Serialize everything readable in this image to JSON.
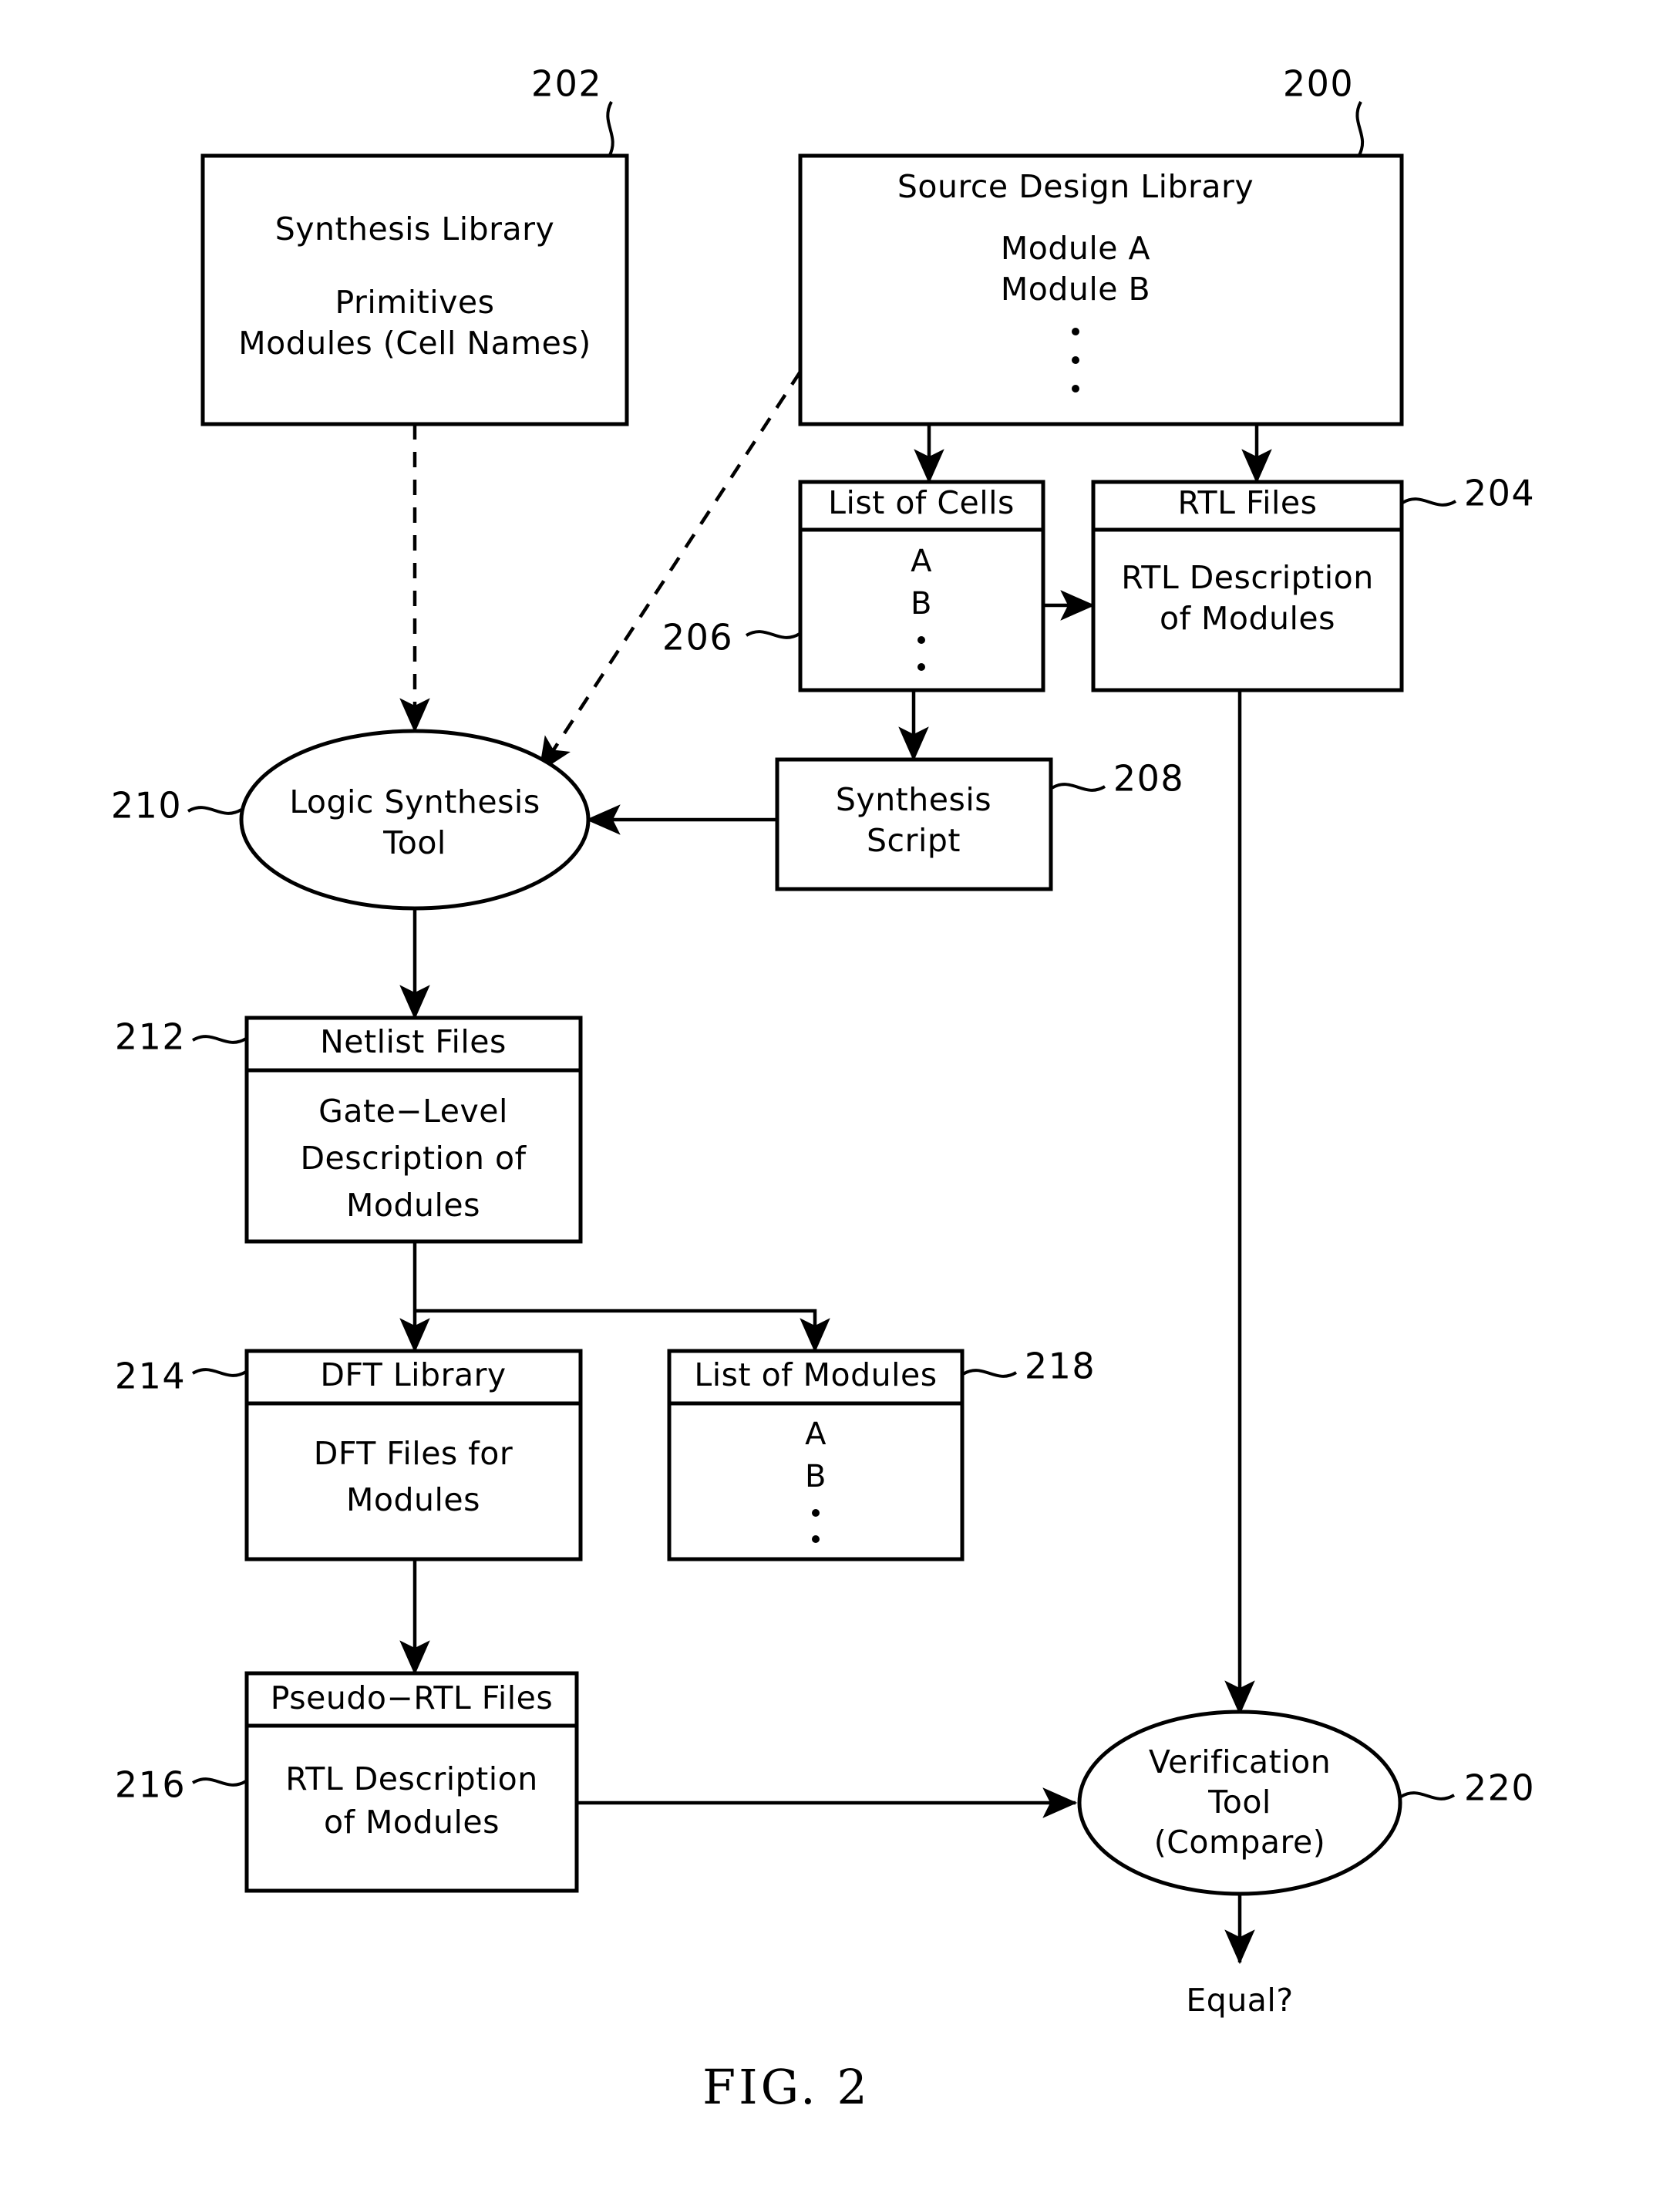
{
  "figure": {
    "caption": "FIG. 2",
    "terminal_label": "Equal?"
  },
  "nodes": {
    "synthesis_library": {
      "ref": "202",
      "title": "Synthesis Library",
      "line1": "Primitives",
      "line2": "Modules (Cell Names)"
    },
    "source_design_library": {
      "ref": "200",
      "title": "Source Design Library",
      "item1": "Module A",
      "item2": "Module B",
      "ellipsis": "vertical-dots"
    },
    "list_of_cells": {
      "ref": "206",
      "header": "List of Cells",
      "item1": "A",
      "item2": "B",
      "ellipsis": "vertical-dots"
    },
    "rtl_files": {
      "ref": "204",
      "header": "RTL Files",
      "body_line1": "RTL Description",
      "body_line2": "of Modules"
    },
    "synthesis_script": {
      "ref": "208",
      "line1": "Synthesis",
      "line2": "Script"
    },
    "logic_synthesis_tool": {
      "ref": "210",
      "line1": "Logic Synthesis",
      "line2": "Tool"
    },
    "netlist_files": {
      "ref": "212",
      "header": "Netlist Files",
      "body_line1": "Gate−Level",
      "body_line2": "Description of",
      "body_line3": "Modules"
    },
    "dft_library": {
      "ref": "214",
      "header": "DFT Library",
      "body_line1": "DFT Files for",
      "body_line2": "Modules"
    },
    "list_of_modules": {
      "ref": "218",
      "header": "List of Modules",
      "item1": "A",
      "item2": "B",
      "ellipsis": "vertical-dots"
    },
    "pseudo_rtl_files": {
      "ref": "216",
      "header": "Pseudo−RTL Files",
      "body_line1": "RTL Description",
      "body_line2": "of Modules"
    },
    "verification_tool": {
      "ref": "220",
      "line1": "Verification",
      "line2": "Tool",
      "line3": "(Compare)"
    }
  },
  "colors": {
    "ink": "#000000",
    "paper": "#ffffff"
  }
}
